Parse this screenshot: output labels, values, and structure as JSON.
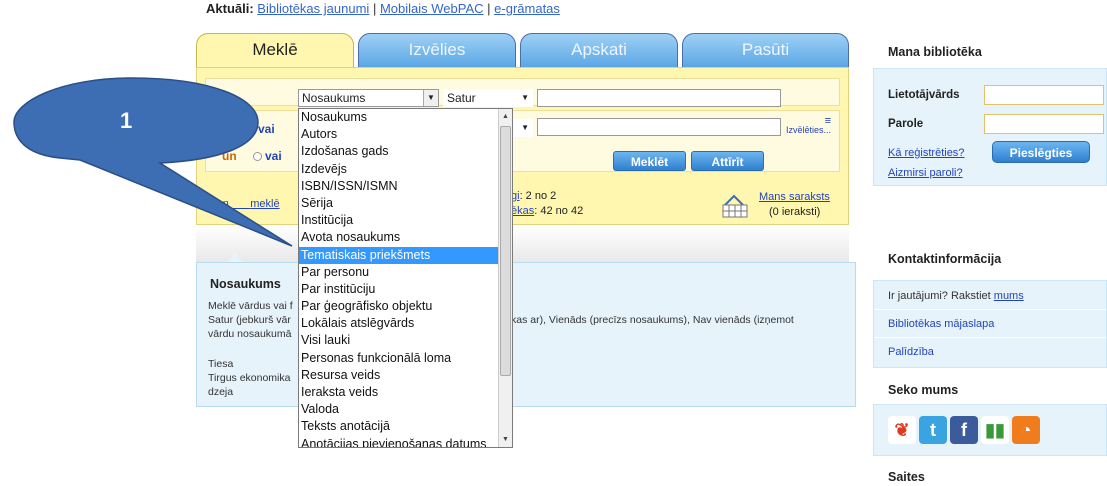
{
  "top_links": {
    "label": "Aktuāli:",
    "link1": "Bibliotēkas jaunumi",
    "sep1": "|",
    "link2": "Mobilais WebPAC",
    "sep2": "|",
    "link3": "e-grāmatas"
  },
  "tabs": [
    {
      "label": "Meklē",
      "active": true
    },
    {
      "label": "Izvēlies",
      "active": false
    },
    {
      "label": "Apskati",
      "active": false
    },
    {
      "label": "Pasūti",
      "active": false
    }
  ],
  "search": {
    "field_select": "Nosaukums",
    "mode_select": "Satur",
    "vai_1": "vai",
    "un": "un",
    "vai_2": "vai",
    "choose": "Izvēlēties...",
    "search_btn": "Meklēt",
    "clear_btn": "Attīrīt",
    "simple_link_start": "Vien",
    "simple_link_end": "meklē",
    "stat1_link": "gi",
    "stat1_value": ": 2 no 2",
    "stat2_link": "ēkas",
    "stat2_value": ": 42 no 42",
    "my_list_link": "Mans saraksts",
    "my_list_count": "(0 ieraksti)"
  },
  "dropdown": {
    "items": [
      "Nosaukums",
      "Autors",
      "Izdošanas gads",
      "Izdevējs",
      "ISBN/ISSN/ISMN",
      "Sērija",
      "Institūcija",
      "Avota nosaukums",
      "Tematiskais priekšmets",
      "Par personu",
      "Par institūciju",
      "Par ģeogrāfisko objektu",
      "Lokālais atslēgvārds",
      "Visi lauki",
      "Personas funkcionālā loma",
      "Resursa veids",
      "Ieraksta veids",
      "Valoda",
      "Teksts anotācijā",
      "Anotācijas pievienošanas datums"
    ],
    "selected_index": 8
  },
  "info": {
    "title": "Nosaukums",
    "line1": "Meklē vārdus vai f",
    "line2a": "Satur (jebkurš vār",
    "line2b": "kas ar), Vienāds (precīzs nosaukums), Nav vienāds (izņemot",
    "line3": "vārdu nosaukumā",
    "ex1": "Tiesa",
    "ex2": "Tirgus ekonomika",
    "ex3": "dzeja"
  },
  "callout": {
    "number": "1",
    "color": "#3d6db3"
  },
  "my_library": {
    "title": "Mana bibliotēka",
    "username_label": "Lietotājvārds",
    "password_label": "Parole",
    "register_link": "Kā reģistrēties?",
    "forgot_link": "Aizmirsi paroli?",
    "login_btn": "Pieslēgties"
  },
  "contact": {
    "title": "Kontaktinformācija",
    "question_text": "Ir jautājumi? Rakstiet",
    "question_link": "mums",
    "homepage_link": "Bibliotēkas mājaslapa",
    "help_link": "Palīdzība"
  },
  "follow": {
    "title": "Seko mums"
  },
  "links": {
    "title": "Saites"
  }
}
